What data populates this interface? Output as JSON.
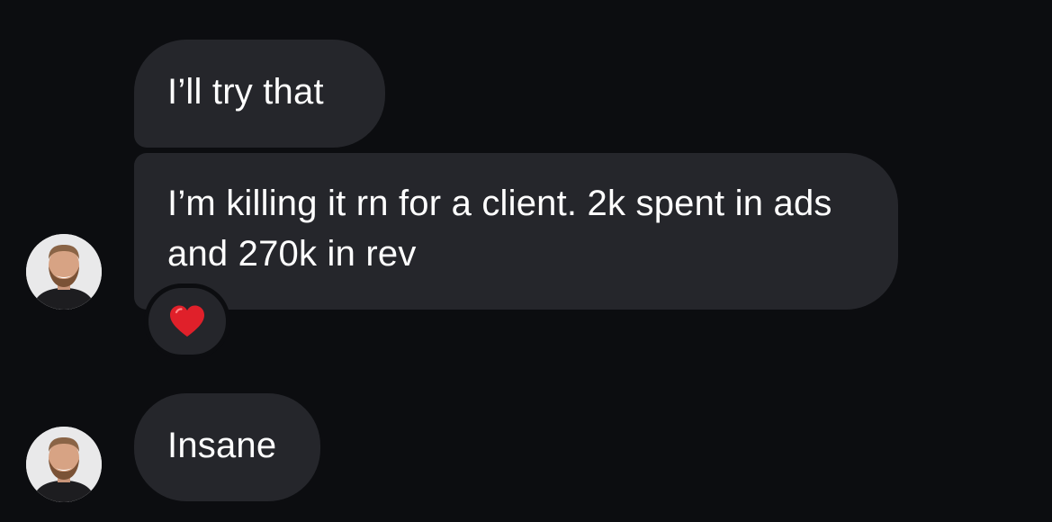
{
  "messages": [
    {
      "text": "I’ll try that"
    },
    {
      "text": "I’m killing it rn for a client. 2k spent in ads and 270k in rev"
    },
    {
      "text": "Insane"
    }
  ],
  "reaction": {
    "icon": "heart-icon",
    "color": "#e0202a"
  },
  "colors": {
    "background": "#0c0d10",
    "bubble": "#25262b",
    "text": "#ffffff"
  }
}
